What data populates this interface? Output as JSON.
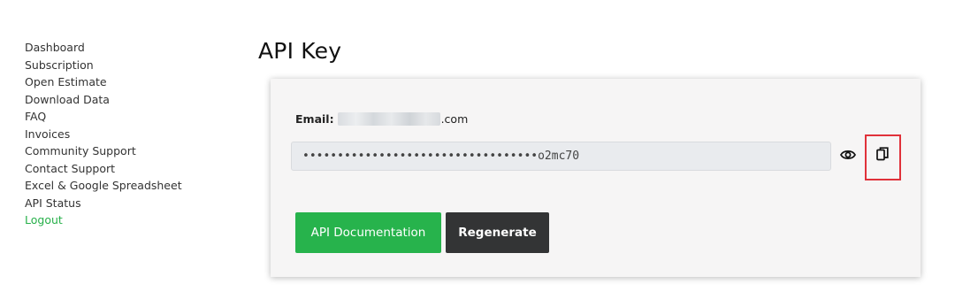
{
  "sidebar": {
    "items": [
      {
        "label": "Dashboard"
      },
      {
        "label": "Subscription"
      },
      {
        "label": "Open Estimate"
      },
      {
        "label": "Download Data"
      },
      {
        "label": "FAQ"
      },
      {
        "label": "Invoices"
      },
      {
        "label": "Community Support"
      },
      {
        "label": "Contact Support"
      },
      {
        "label": "Excel & Google Spreadsheet"
      },
      {
        "label": "API Status"
      },
      {
        "label": "Logout"
      }
    ]
  },
  "page": {
    "title": "API Key"
  },
  "card": {
    "email_label": "Email:",
    "email_suffix": ".com",
    "api_key_value": "••••••••••••••••••••••••••••••••••o2mc70",
    "icons": {
      "reveal": "eye-icon",
      "copy": "copy-icon"
    },
    "highlight_color": "#e0313a",
    "buttons": {
      "documentation_label": "API Documentation",
      "regenerate_label": "Regenerate"
    }
  },
  "colors": {
    "accent_green": "#27b34c",
    "dark_button": "#333435",
    "logout_link": "#27b04a"
  }
}
